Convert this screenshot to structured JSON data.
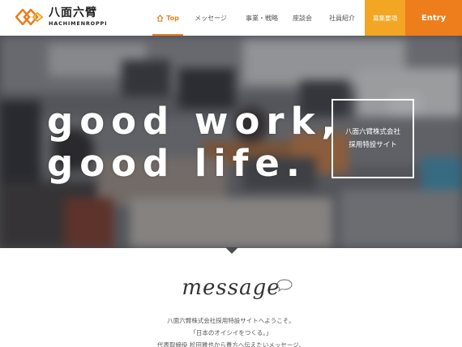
{
  "brand": {
    "name_jp": "八面六臂",
    "name_en": "HACHIMENROPPI",
    "accent": "#ee7d1c",
    "accent_light": "#f2a623"
  },
  "nav": {
    "items": [
      {
        "label": "Top",
        "icon": "home-icon",
        "active": true
      },
      {
        "label": "メッセージ",
        "active": false
      },
      {
        "label": "事業・戦略",
        "active": false
      },
      {
        "label": "座談会",
        "active": false
      },
      {
        "label": "社員紹介",
        "active": false
      }
    ],
    "recruit_label": "募集要項",
    "entry_label": "Entry"
  },
  "hero": {
    "tagline_line1": "good work,",
    "tagline_line2": "good life.",
    "badge_line1": "八面六臂株式会社",
    "badge_line2": "採用特設サイト"
  },
  "message": {
    "title": "message",
    "icon": "speech-bubble-icon",
    "lines": [
      "八面六臂株式会社採用特設サイトへようこそ。",
      "「日本のオイシイをつくる。」",
      "代表取締役 松田雅也から貴方へ伝えたいメッセージ。"
    ]
  }
}
